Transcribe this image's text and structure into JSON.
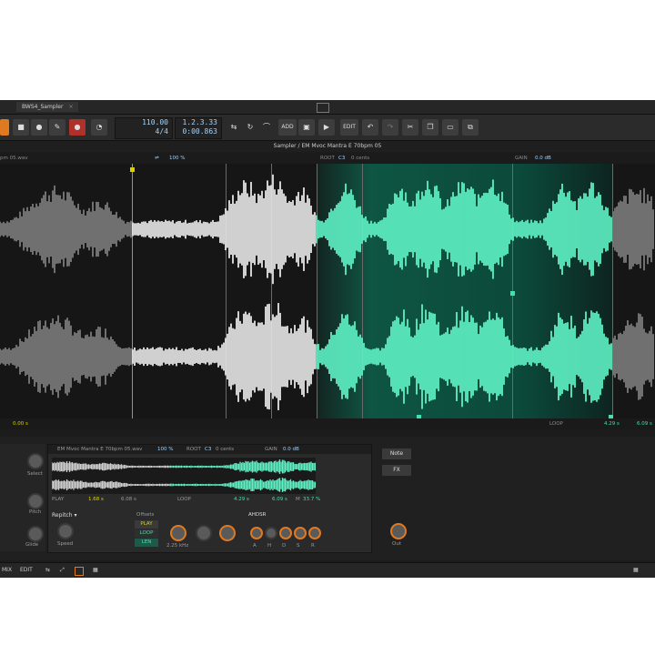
{
  "app": {
    "tab_label": "BWS4_Sampler",
    "tab_close": "×"
  },
  "toolbar": {
    "tempo": "110.00",
    "signature": "4/4",
    "position_bars": "1.2.3.33",
    "position_time": "0:00.863",
    "add_label": "ADD",
    "edit_label": "EDIT"
  },
  "editor": {
    "title": "Sampler / EM Mvoc Mantra E 70bpm 05",
    "left_label": "pm 05.wav",
    "speed": "100 %",
    "root_label": "ROOT",
    "root_note": "C3",
    "cents": "0 cents",
    "gain_label": "GAIN",
    "gain_value": "0.0 dB",
    "start_time": "0.00 s",
    "loop_label": "LOOP",
    "loop_start": "4.29 s",
    "loop_end": "6.09 s"
  },
  "device": {
    "file": "EM Mvoc Mantra E 70bpm 05.wav",
    "speed": "100 %",
    "root_label": "ROOT",
    "root_note": "C3",
    "cents": "0 cents",
    "gain_label": "GAIN",
    "gain_value": "0.0 dB",
    "play_label": "PLAY",
    "play_start": "1.68 s",
    "play_end": "6.08 s",
    "loop_label": "LOOP",
    "loop_start": "4.29 s",
    "loop_end": "6.09 s",
    "xfade_label": "M",
    "xfade_value": "33.7 %",
    "mode": "Repitch",
    "speed_knob": "Speed",
    "offsets": "Offsets",
    "mode_play": "PLAY",
    "mode_loop": "LOOP",
    "mode_len": "LEN",
    "freq": "2.25 kHz",
    "env": "AHDSR",
    "env_a": "A",
    "env_h": "H",
    "env_d": "D",
    "env_s": "S",
    "env_r": "R",
    "note_btn": "Note",
    "fx_btn": "FX",
    "out": "Out",
    "select": "Select",
    "pitch": "Pitch",
    "glide": "Glide"
  },
  "footer": {
    "mix": "MIX",
    "edit": "EDIT"
  },
  "colors": {
    "accent": "#3fe0b2",
    "orange": "#e07a20",
    "record": "#c0392b"
  }
}
